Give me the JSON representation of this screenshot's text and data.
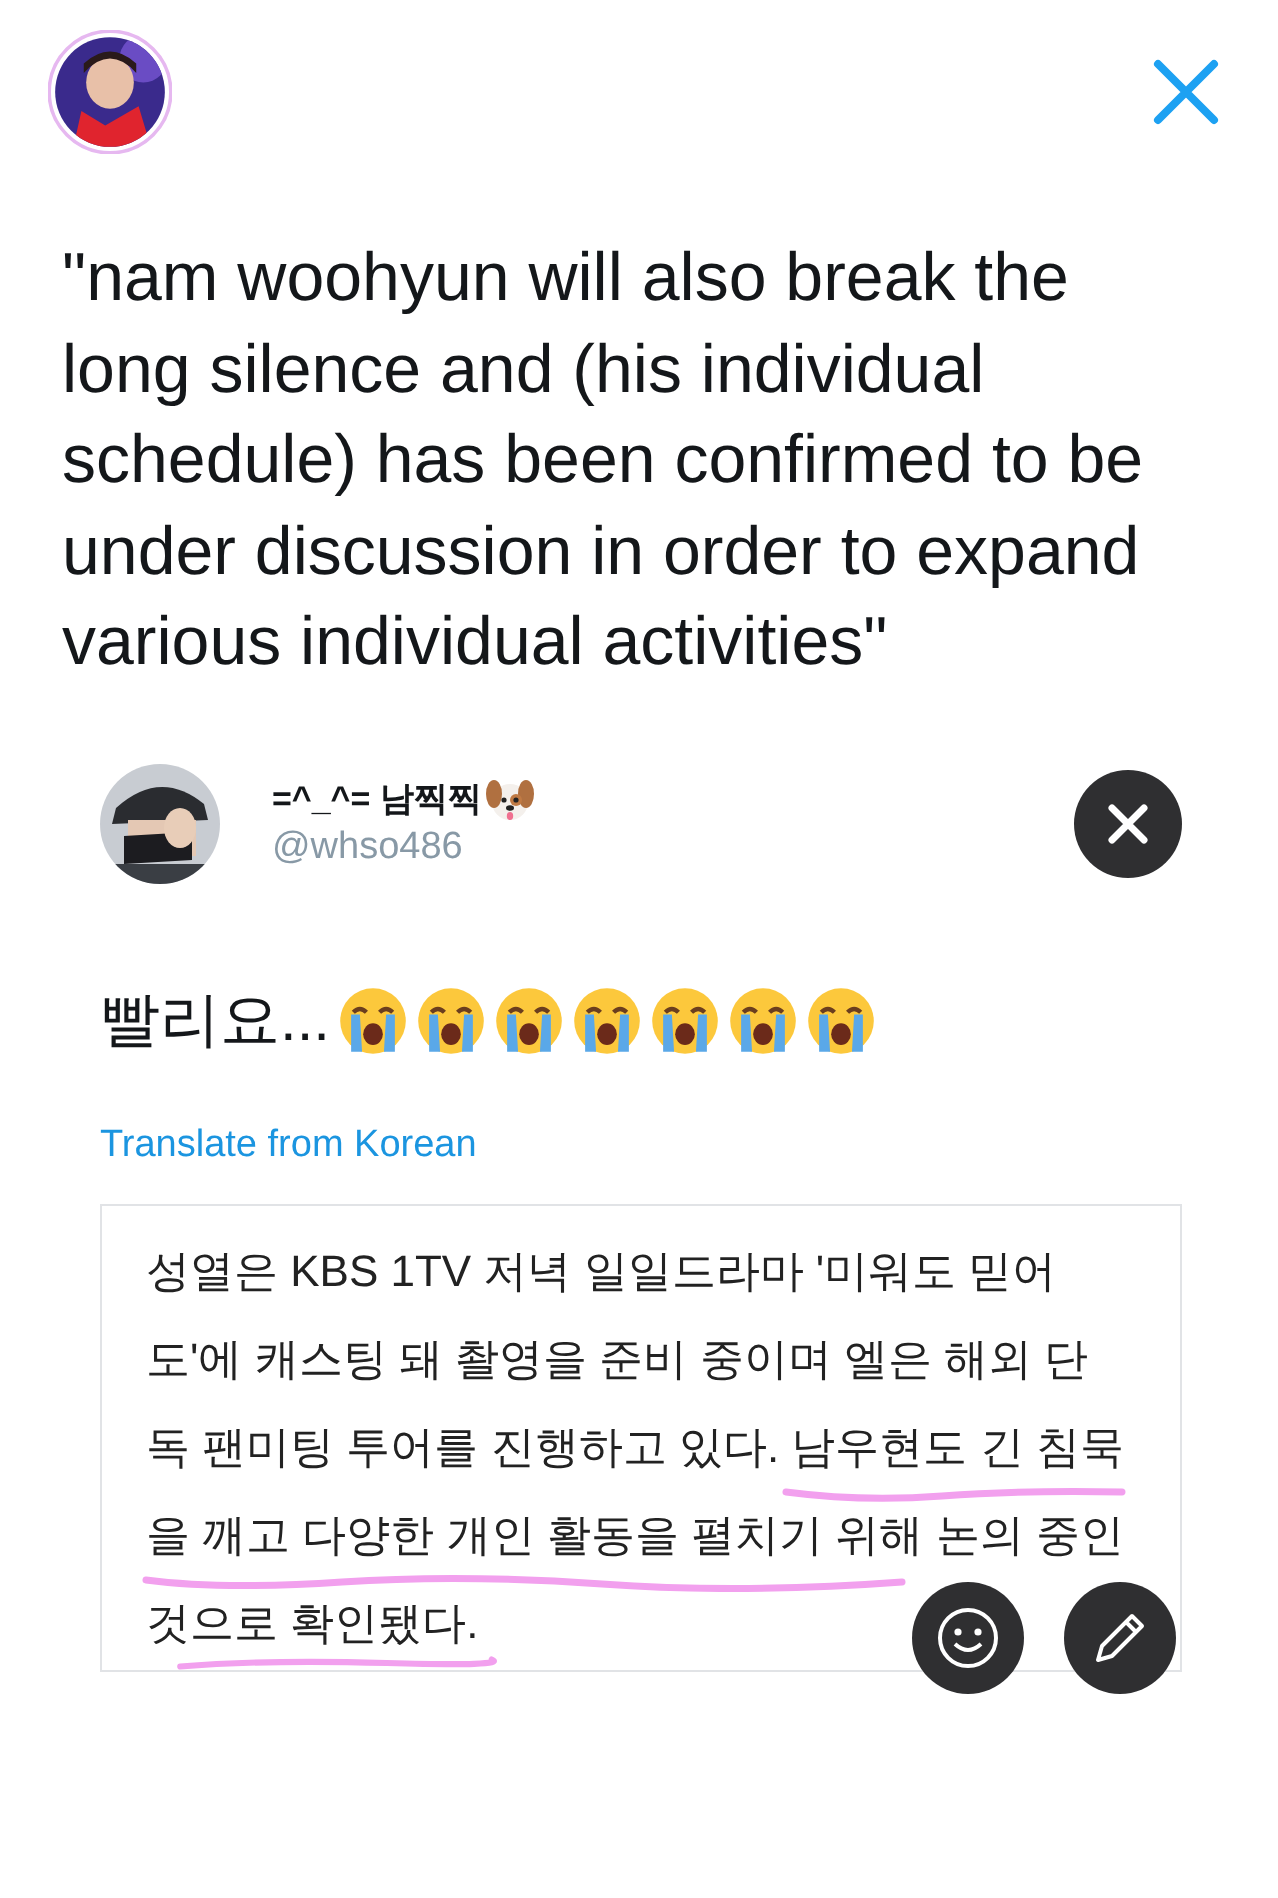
{
  "quote": "\"nam woohyun will also break the long silence and (his individual schedule) has been confirmed to be under discussion in order to expand various individual activities\"",
  "tweet": {
    "display_name": "=^_^= 남찍찍",
    "handle": "@whso486",
    "text": "빨리요...",
    "emojis": [
      {
        "kind": "crying-face"
      },
      {
        "kind": "crying-face"
      },
      {
        "kind": "crying-face"
      },
      {
        "kind": "crying-face"
      },
      {
        "kind": "crying-face"
      },
      {
        "kind": "crying-face"
      },
      {
        "kind": "crying-face"
      }
    ],
    "translate": "Translate from Korean"
  },
  "article": {
    "kind": "picture-of-text",
    "lines": [
      "성열은 KBS 1TV 저녁 일일드라마 '미워도 믿어",
      "도'에 캐스팅 돼 촬영을 준비 중이며 엘은 해외 단",
      "독 팬미팅 투어를 진행하고 있다. 남우현도 긴 침묵",
      "을 깨고 다양한 개인 활동을 펼치기 위해 논의 중인",
      "것으로 확인됐다."
    ]
  }
}
